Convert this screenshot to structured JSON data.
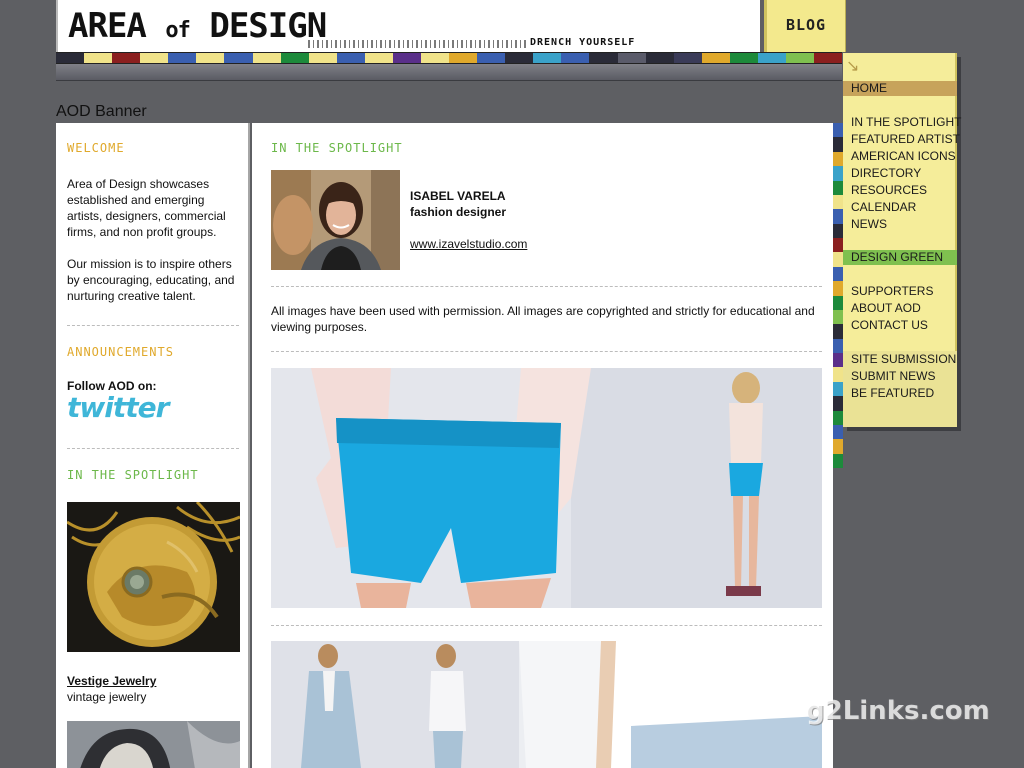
{
  "header": {
    "logo_text_1": "AREA",
    "logo_text_2": "of",
    "logo_text_3": "DESIGN",
    "tagline": "DRENCH YOURSELF",
    "blog_label": "BLOG",
    "banner_label": "AOD Banner",
    "strip_colors": [
      "#2a2b38",
      "#f0e38a",
      "#8b1f1f",
      "#f0e38a",
      "#3a5fb0",
      "#f0e38a",
      "#3a5fb0",
      "#f0e38a",
      "#1d8a3b",
      "#f0e38a",
      "#3a5fb0",
      "#f0e38a",
      "#5a2f8a",
      "#f0e38a",
      "#e0a92c",
      "#3a5fb0",
      "#2a2b38",
      "#3aa2c9",
      "#3a5fb0",
      "#2a2b38",
      "#5a5b6a",
      "#2a2b38",
      "#3a3b58",
      "#e0a92c",
      "#1d8a3b",
      "#3aa2c9",
      "#7fc04f",
      "#8b1f1f"
    ]
  },
  "nav": {
    "items": [
      {
        "label": "HOME",
        "style": "home"
      },
      {
        "label": "IN THE SPOTLIGHT",
        "style": ""
      },
      {
        "label": "FEATURED ARTIST",
        "style": ""
      },
      {
        "label": "AMERICAN ICONS",
        "style": ""
      },
      {
        "label": "DIRECTORY",
        "style": ""
      },
      {
        "label": "RESOURCES",
        "style": ""
      },
      {
        "label": "CALENDAR",
        "style": ""
      },
      {
        "label": "NEWS",
        "style": ""
      },
      {
        "label": "DESIGN GREEN",
        "style": "green"
      },
      {
        "label": "SUPPORTERS",
        "style": ""
      },
      {
        "label": "ABOUT AOD",
        "style": ""
      },
      {
        "label": "CONTACT US",
        "style": ""
      },
      {
        "label": "SITE SUBMISSION",
        "style": ""
      },
      {
        "label": "SUBMIT NEWS",
        "style": ""
      },
      {
        "label": "BE FEATURED",
        "style": ""
      }
    ],
    "side_strip_colors": [
      "#3a5fb0",
      "#2a2b38",
      "#e0a92c",
      "#3aa2c9",
      "#1d8a3b",
      "#f0e38a",
      "#3a5fb0",
      "#2a2b38",
      "#8b1f1f",
      "#f0e38a",
      "#3a5fb0",
      "#e0a92c",
      "#1d8a3b",
      "#7fc04f",
      "#2a2b38",
      "#3a5fb0",
      "#5a2f8a",
      "#f0e38a",
      "#3aa2c9",
      "#2a2b38",
      "#1d8a3b",
      "#3a5fb0",
      "#e0a92c",
      "#1d8a3b"
    ]
  },
  "left": {
    "welcome_heading": "WELCOME",
    "welcome_text_1": "Area of Design showcases established and emerging artists, designers, commercial firms, and non profit groups.",
    "welcome_text_2": "Our mission is to inspire others by encouraging, educating, and nurturing creative talent.",
    "announcements_heading": "ANNOUNCEMENTS",
    "follow_label": "Follow AOD on:",
    "twitter_word": "twitter",
    "spotlight_heading": "IN THE SPOTLIGHT",
    "spotlight_title": "Vestige Jewelry",
    "spotlight_subtitle": "vintage jewelry"
  },
  "main": {
    "spotlight_heading": "IN THE SPOTLIGHT",
    "artist_name": "ISABEL VARELA",
    "artist_role": "fashion designer",
    "artist_link": "www.izavelstudio.com",
    "disclaimer": "All images have been used with permission. All images are copyrighted and strictly for educational and viewing purposes."
  },
  "watermark": "g2Links.com",
  "colors": {
    "heading_orange": "#e0a92c",
    "heading_green": "#6cb84a",
    "nav_bg": "#f5ed9a",
    "nav_home": "#c7a35b",
    "nav_green": "#7fc04f",
    "page_bg": "#5e5f63",
    "shorts_blue": "#1aa8e0"
  }
}
